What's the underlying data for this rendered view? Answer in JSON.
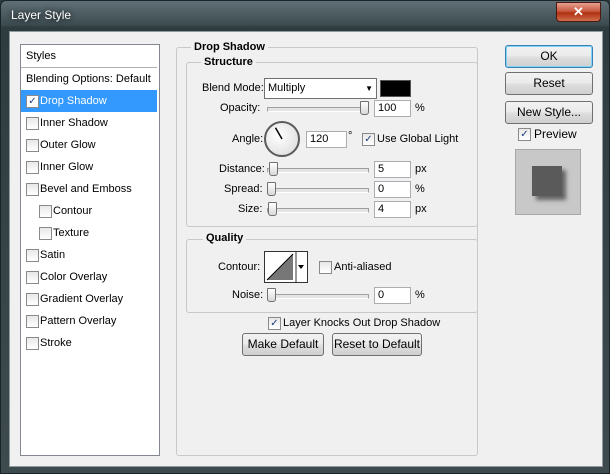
{
  "window": {
    "title": "Layer Style",
    "close_glyph": "✕"
  },
  "list": {
    "header": "Styles",
    "items": [
      {
        "label": "Blending Options: Default",
        "checkbox": false,
        "checked": false,
        "indent": false,
        "selected": false
      },
      {
        "label": "Drop Shadow",
        "checkbox": true,
        "checked": true,
        "indent": false,
        "selected": true
      },
      {
        "label": "Inner Shadow",
        "checkbox": true,
        "checked": false,
        "indent": false,
        "selected": false
      },
      {
        "label": "Outer Glow",
        "checkbox": true,
        "checked": false,
        "indent": false,
        "selected": false
      },
      {
        "label": "Inner Glow",
        "checkbox": true,
        "checked": false,
        "indent": false,
        "selected": false
      },
      {
        "label": "Bevel and Emboss",
        "checkbox": true,
        "checked": false,
        "indent": false,
        "selected": false
      },
      {
        "label": "Contour",
        "checkbox": true,
        "checked": false,
        "indent": true,
        "selected": false
      },
      {
        "label": "Texture",
        "checkbox": true,
        "checked": false,
        "indent": true,
        "selected": false
      },
      {
        "label": "Satin",
        "checkbox": true,
        "checked": false,
        "indent": false,
        "selected": false
      },
      {
        "label": "Color Overlay",
        "checkbox": true,
        "checked": false,
        "indent": false,
        "selected": false
      },
      {
        "label": "Gradient Overlay",
        "checkbox": true,
        "checked": false,
        "indent": false,
        "selected": false
      },
      {
        "label": "Pattern Overlay",
        "checkbox": true,
        "checked": false,
        "indent": false,
        "selected": false
      },
      {
        "label": "Stroke",
        "checkbox": true,
        "checked": false,
        "indent": false,
        "selected": false
      }
    ]
  },
  "drop_shadow": {
    "title": "Drop Shadow",
    "structure": {
      "title": "Structure",
      "blend_mode_label": "Blend Mode:",
      "blend_mode_value": "Multiply",
      "shadow_color": "#000000",
      "opacity_label": "Opacity:",
      "opacity_value": "100",
      "opacity_fraction": 1.0,
      "opacity_unit": "%",
      "angle_label": "Angle:",
      "angle_value": "120",
      "angle_degrees": 120,
      "angle_unit": "°",
      "use_global_light_label": "Use Global Light",
      "use_global_light_checked": true,
      "distance_label": "Distance:",
      "distance_value": "5",
      "distance_fraction": 0.02,
      "distance_unit": "px",
      "spread_label": "Spread:",
      "spread_value": "0",
      "spread_fraction": 0.0,
      "spread_unit": "%",
      "size_label": "Size:",
      "size_value": "4",
      "size_fraction": 0.016,
      "size_unit": "px"
    },
    "quality": {
      "title": "Quality",
      "contour_label": "Contour:",
      "anti_aliased_label": "Anti-aliased",
      "anti_aliased_checked": false,
      "noise_label": "Noise:",
      "noise_value": "0",
      "noise_fraction": 0.0,
      "noise_unit": "%"
    },
    "knocks_out_label": "Layer Knocks Out Drop Shadow",
    "knocks_out_checked": true,
    "make_default_label": "Make Default",
    "reset_default_label": "Reset to Default"
  },
  "buttons": {
    "ok": "OK",
    "reset": "Reset",
    "new_style": "New Style...",
    "preview_label": "Preview",
    "preview_checked": true
  },
  "check_glyph": "✓",
  "colors": {
    "selection": "#3399ff",
    "preview_square": "#5a5a5a"
  }
}
